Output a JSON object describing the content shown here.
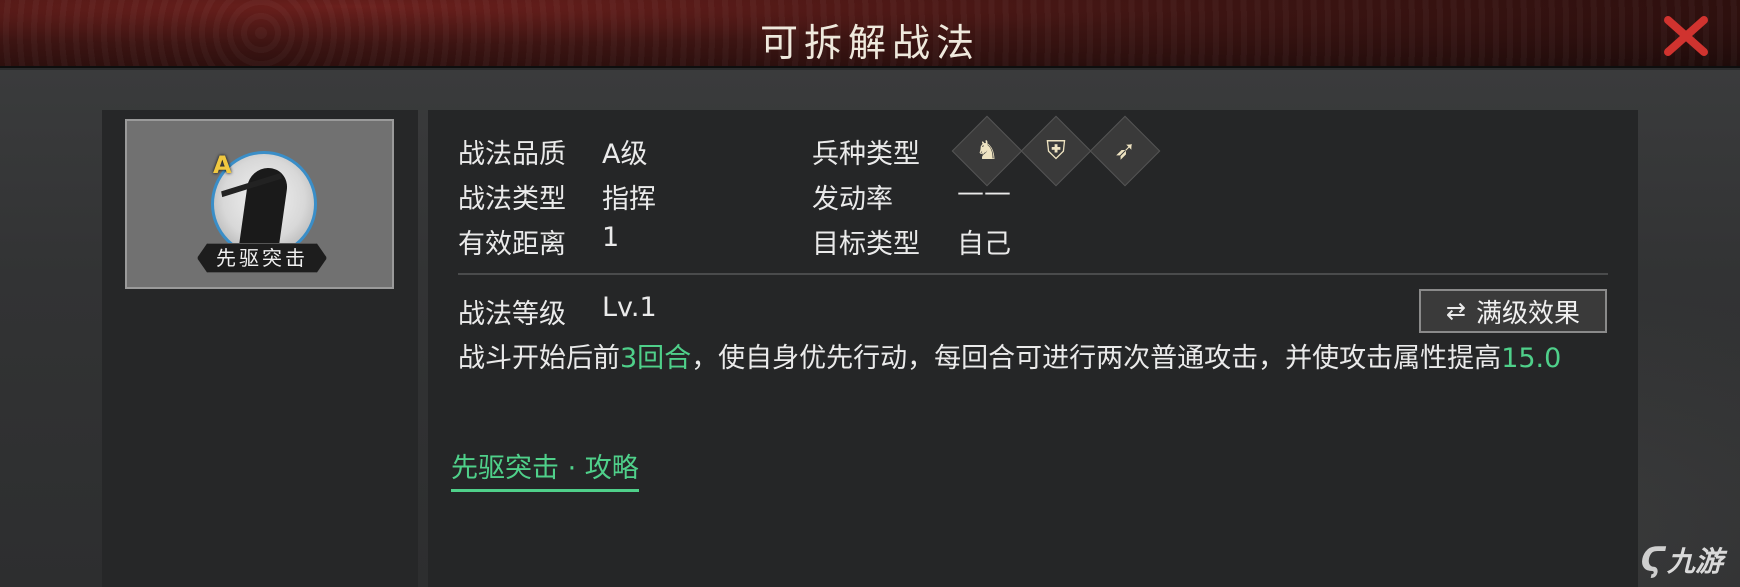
{
  "header": {
    "title": "可拆解战法"
  },
  "skill_card": {
    "grade": "A",
    "name": "先驱突击"
  },
  "info": {
    "quality_label": "战法品质",
    "quality_value": "A级",
    "type_label": "战法类型",
    "type_value": "指挥",
    "range_label": "有效距离",
    "range_value": "1",
    "troop_label": "兵种类型",
    "troop_icons": [
      "cavalry-icon",
      "shield-icon",
      "bow-icon"
    ],
    "rate_label": "发动率",
    "rate_value": "——",
    "target_label": "目标类型",
    "target_value": "自己"
  },
  "level": {
    "label": "战法等级",
    "value": "Lv.1",
    "max_effect_button": "满级效果"
  },
  "description": {
    "part1": "战斗开始后前",
    "highlight1": "3回合",
    "part2": "，使自身优先行动，每回合可进行两次普通攻击，并使攻击属性提高",
    "highlight2": "15.0"
  },
  "guide_link": "先驱突击 · 攻略",
  "watermark": "九游",
  "colors": {
    "highlight": "#4fd08a",
    "close_red": "#d0332f",
    "portrait_ring": "#3a8ec8"
  }
}
